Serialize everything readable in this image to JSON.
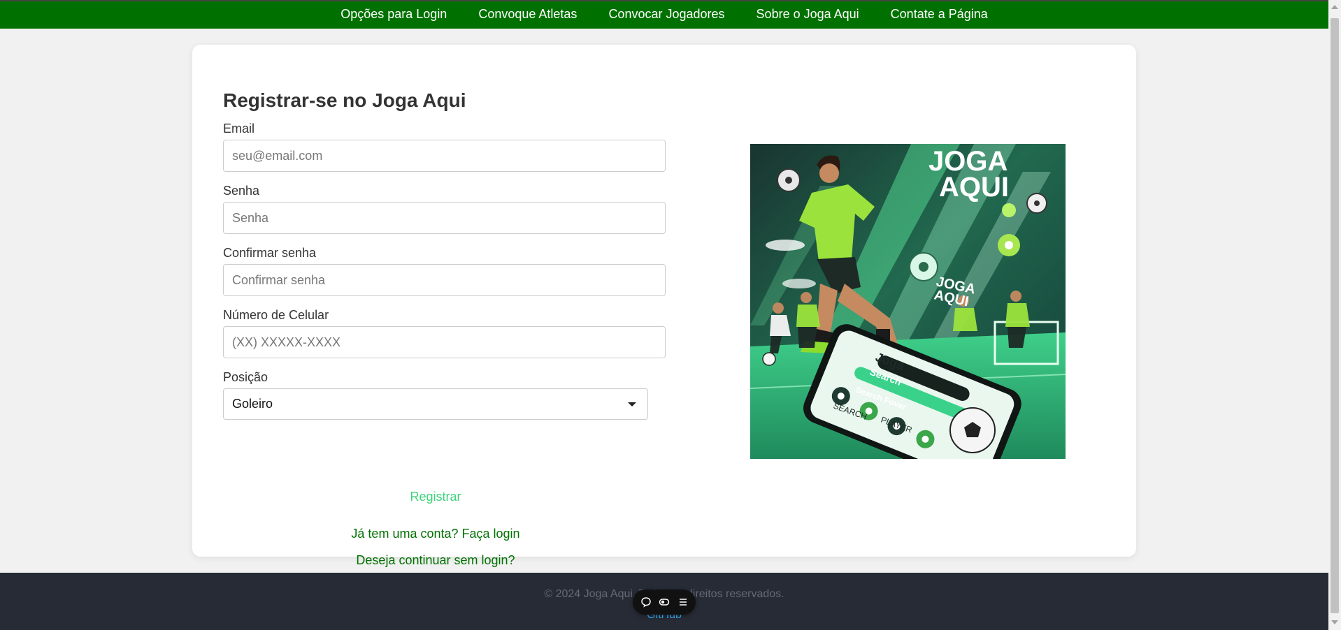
{
  "nav": {
    "items": [
      {
        "label": "Opções para Login"
      },
      {
        "label": "Convoque Atletas"
      },
      {
        "label": "Convocar Jogadores"
      },
      {
        "label": "Sobre o Joga Aqui"
      },
      {
        "label": "Contate a Página"
      }
    ]
  },
  "form": {
    "title": "Registrar-se no Joga Aqui",
    "email": {
      "label": "Email",
      "placeholder": "seu@email.com",
      "value": ""
    },
    "password": {
      "label": "Senha",
      "placeholder": "Senha",
      "value": ""
    },
    "confirm_password": {
      "label": "Confirmar senha",
      "placeholder": "Confirmar senha",
      "value": ""
    },
    "phone": {
      "label": "Número de Celular",
      "placeholder": "(XX) XXXXX-XXXX",
      "value": ""
    },
    "position": {
      "label": "Posição",
      "selected": "Goleiro"
    },
    "submit_label": "Registrar",
    "login_link": "Já tem uma conta? Faça login",
    "guest_link": "Deseja continuar sem login?"
  },
  "hero_image": {
    "logo_text_line1": "JOGA",
    "logo_text_line2": "AQUI",
    "phone_logo_line1": "JOGA",
    "phone_logo_line2": "AQUI",
    "phone_screen_line1": "Joga",
    "phone_screen_search": "Search",
    "phone_screen_search_bar": "Search Fover",
    "phone_screen_label1": "SEARCH",
    "phone_screen_label2": "PLAYER"
  },
  "footer": {
    "copyright": "© 2024 Joga Aqui. Todos os direitos reservados.",
    "link": "GitHub"
  },
  "colors": {
    "nav_bg": "#007100",
    "link_green": "#007100",
    "register_green": "#3dd37a",
    "footer_bg": "#262b35",
    "footer_link": "#36b3ff"
  },
  "floating_toolbar": {
    "icons": [
      "chat-bubble-icon",
      "toggle-icon",
      "menu-icon"
    ]
  }
}
